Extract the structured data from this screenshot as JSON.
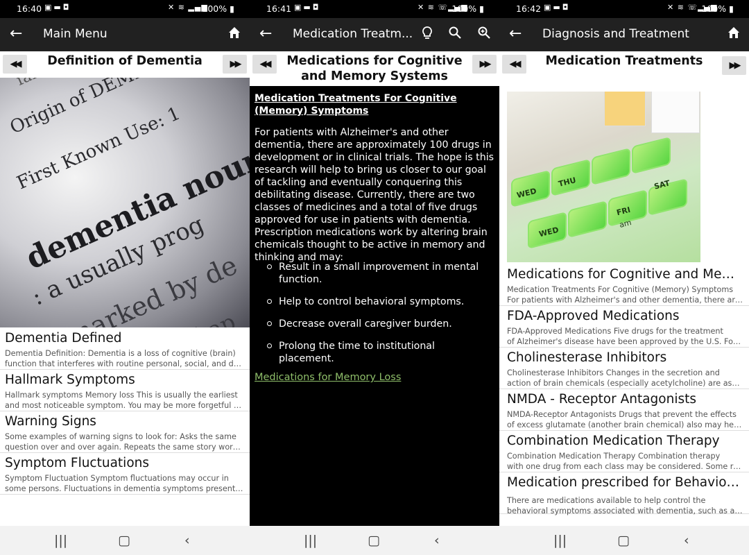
{
  "screens": [
    {
      "status": {
        "time": "16:40",
        "battery": "100%"
      },
      "appbar": {
        "title": "Main Menu"
      },
      "nav": {
        "title": "Definition of Dementia"
      },
      "hero_words": {
        "line1": "fanaticism bor",
        "line2": "Origin of DEMEN",
        "line3": "First Known Use: 1",
        "line4": "dementia noun",
        "line5": ": a usually prog",
        "line6": "marked by de",
        "line7": "tional ap"
      },
      "items": [
        {
          "title": "Dementia Defined",
          "line1": "Dementia Definition:  Dementia is a loss of cognitive (brain)",
          "line2": "function that interferes with routine personal, social, and daily..."
        },
        {
          "title": "Hallmark Symptoms",
          "line1": "Hallmark symptoms  Memory loss  This is usually the earliest",
          "line2": "and most noticeable symptom. You may be more forgetful at ..."
        },
        {
          "title": "Warning Signs",
          "line1": "Some examples of warning signs to look for:  Asks the same",
          "line2": "question over and over again.  Repeats the same story word-f..."
        },
        {
          "title": "Symptom Fluctuations",
          "line1": "Symptom Fluctuation  Symptom fluctuations may occur in",
          "line2": "some persons. Fluctuations in dementia symptoms present a..."
        }
      ]
    },
    {
      "status": {
        "time": "16:41",
        "battery": "100%"
      },
      "appbar": {
        "title": "Medication Treatm..."
      },
      "nav": {
        "title": "Medications for Cognitive and Memory Systems"
      },
      "article": {
        "heading": "Medication Treatments For Cognitive (Memory) Symptoms",
        "paragraph": "For patients with Alzheimer's and other dementia, there are approximately 100 drugs in development or in clinical trials. The hope is this research will help to bring us closer to our goal of tackling and eventually conquering this debilitating disease. Currently, there are two classes of medicines and a total of five drugs approved for use in patients with dementia. Prescription medications work by altering brain chemicals thought to be active in memory and thinking and may:",
        "bullets": [
          "Result in a small improvement in mental function.",
          "Help to control behavioral symptoms.",
          "Decrease overall caregiver burden.",
          "Prolong the time to institutional placement."
        ],
        "link": "Medications for Memory Loss"
      }
    },
    {
      "status": {
        "time": "16:42",
        "battery": "100%"
      },
      "appbar": {
        "title": "Diagnosis and Treatment"
      },
      "nav": {
        "title": "Medication Treatments"
      },
      "pill_labels": {
        "wed": "WED",
        "thu": "THU",
        "fri": "FRI",
        "sat": "SAT",
        "wed2": "WED",
        "am": "am"
      },
      "items": [
        {
          "title": "Medications for Cognitive and Memo...",
          "line1": "Medication Treatments For Cognitive (Memory) Symptoms",
          "line2": "For patients with Alzheimer's and other dementia, there are ..."
        },
        {
          "title": "FDA-Approved Medications",
          "line1": "FDA-Approved Medications   Five drugs for the treatment",
          "line2": "of Alzheimer's disease have been approved by the U.S. Food..."
        },
        {
          "title": "Cholinesterase Inhibitors",
          "line1": "Cholinesterase Inhibitors   Changes in the secretion and",
          "line2": "action of brain chemicals (especially acetylcholine) are asso..."
        },
        {
          "title": "NMDA - Receptor Antagonists",
          "line1": "NMDA-Receptor Antagonists   Drugs that prevent the effects",
          "line2": "of excess glutamate (another brain chemical) also may help ..."
        },
        {
          "title": "Combination Medication Therapy",
          "line1": "Combination Medication Therapy   Combination therapy",
          "line2": "with one drug from each class may be considered. Some re..."
        },
        {
          "title": "Medication prescribed for Behavioral...",
          "line1": "There are medications available to help control the",
          "line2": "behavioral symptoms associated with dementia, such as an..."
        }
      ]
    }
  ],
  "icons": {
    "back": "arrow-left",
    "home": "home",
    "lightbulb": "lightbulb",
    "search": "magnifier",
    "zoom": "zoom-in",
    "prev": "rewind",
    "next": "fast-forward",
    "recents": "recents",
    "home_nav": "circle",
    "back_nav": "chevron-left"
  }
}
